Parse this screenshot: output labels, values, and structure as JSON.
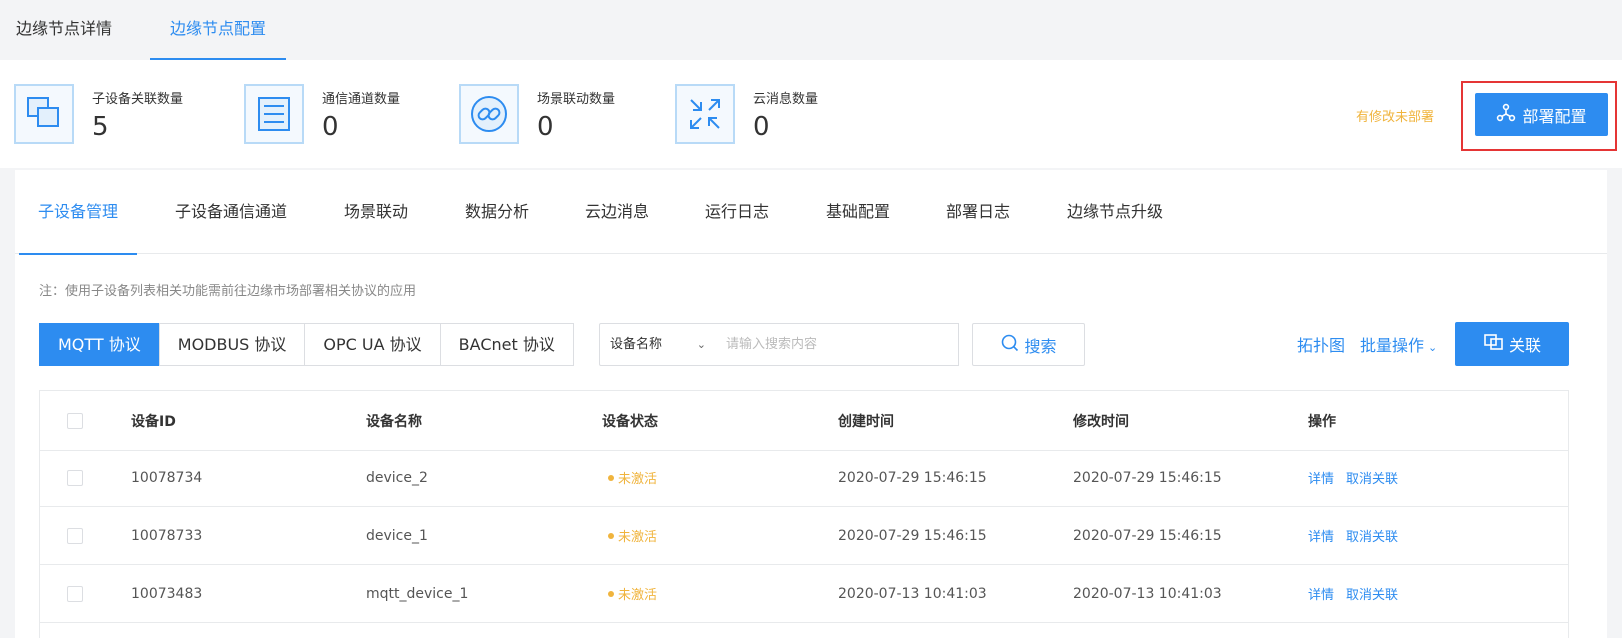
{
  "top_tabs": [
    {
      "label": "边缘节点详情",
      "active": false
    },
    {
      "label": "边缘节点配置",
      "active": true
    }
  ],
  "stats": [
    {
      "label": "子设备关联数量",
      "value": "5",
      "icon": "devices-icon"
    },
    {
      "label": "通信通道数量",
      "value": "0",
      "icon": "channel-list-icon"
    },
    {
      "label": "场景联动数量",
      "value": "0",
      "icon": "link-icon"
    },
    {
      "label": "云消息数量",
      "value": "0",
      "icon": "arrows-icon"
    }
  ],
  "deploy": {
    "modified_text": "有修改未部署",
    "button_label": "部署配置",
    "icon": "deploy-icon"
  },
  "sub_tabs": [
    {
      "label": "子设备管理",
      "active": true
    },
    {
      "label": "子设备通信通道",
      "active": false
    },
    {
      "label": "场景联动",
      "active": false
    },
    {
      "label": "数据分析",
      "active": false
    },
    {
      "label": "云边消息",
      "active": false
    },
    {
      "label": "运行日志",
      "active": false
    },
    {
      "label": "基础配置",
      "active": false
    },
    {
      "label": "部署日志",
      "active": false
    },
    {
      "label": "边缘节点升级",
      "active": false
    }
  ],
  "note": "注：使用子设备列表相关功能需前往边缘市场部署相关协议的应用",
  "protocols": [
    {
      "label": "MQTT 协议",
      "active": true
    },
    {
      "label": "MODBUS 协议",
      "active": false
    },
    {
      "label": "OPC UA 协议",
      "active": false
    },
    {
      "label": "BACnet 协议",
      "active": false
    }
  ],
  "search": {
    "field_selected": "设备名称",
    "placeholder": "请输入搜索内容",
    "value": "",
    "button_label": "搜索"
  },
  "actions": {
    "topology_label": "拓扑图",
    "batch_label": "批量操作",
    "associate_label": "关联"
  },
  "table": {
    "headers": [
      "设备ID",
      "设备名称",
      "设备状态",
      "创建时间",
      "修改时间",
      "操作"
    ],
    "rows": [
      {
        "id": "10078734",
        "name": "device_2",
        "status": "未激活",
        "created": "2020-07-29 15:46:15",
        "modified": "2020-07-29 15:46:15",
        "op_detail": "详情",
        "op_unlink": "取消关联"
      },
      {
        "id": "10078733",
        "name": "device_1",
        "status": "未激活",
        "created": "2020-07-29 15:46:15",
        "modified": "2020-07-29 15:46:15",
        "op_detail": "详情",
        "op_unlink": "取消关联"
      },
      {
        "id": "10073483",
        "name": "mqtt_device_1",
        "status": "未激活",
        "created": "2020-07-13 10:41:03",
        "modified": "2020-07-13 10:41:03",
        "op_detail": "详情",
        "op_unlink": "取消关联"
      }
    ]
  },
  "colors": {
    "primary": "#2d8cf0",
    "warning": "#f0b43d",
    "highlight": "#e53535"
  }
}
